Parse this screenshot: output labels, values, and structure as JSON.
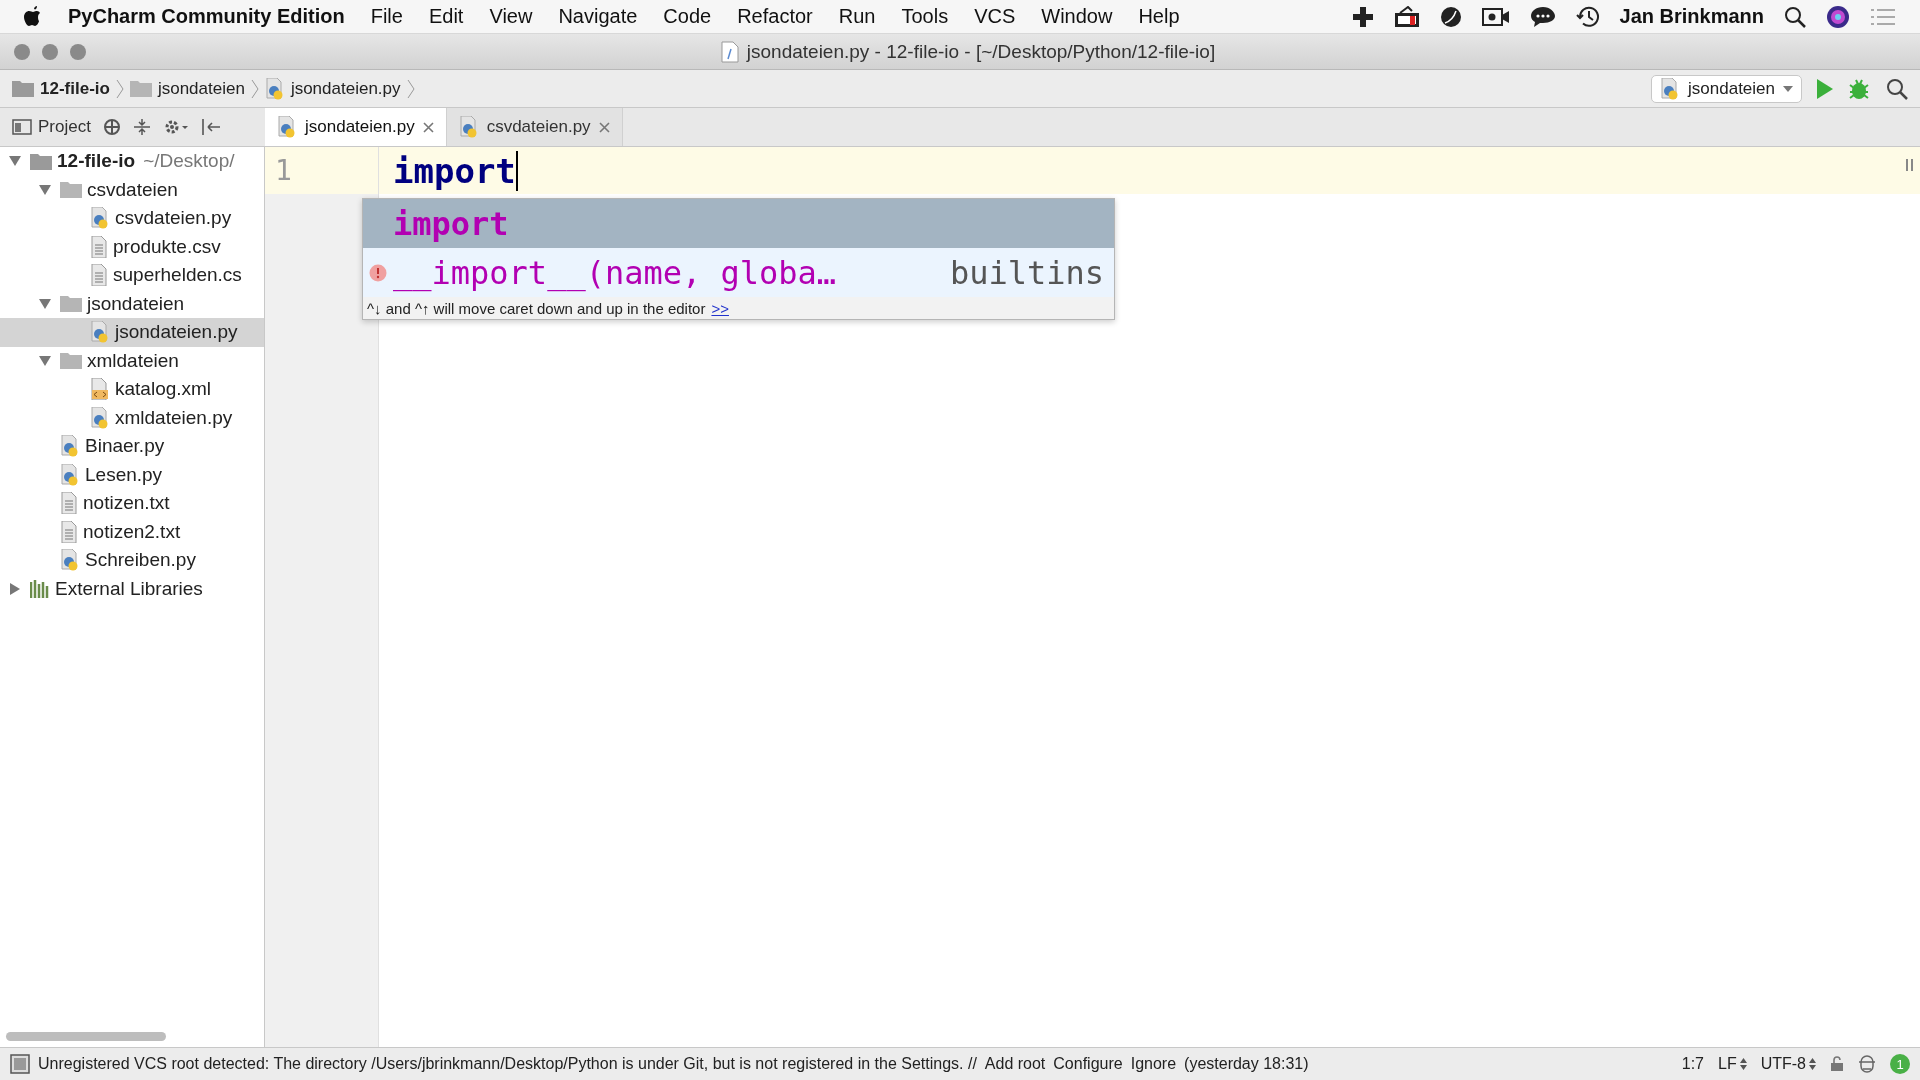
{
  "menu_bar": {
    "app_name": "PyCharm Community Edition",
    "items": [
      "File",
      "Edit",
      "View",
      "Navigate",
      "Code",
      "Refactor",
      "Run",
      "Tools",
      "VCS",
      "Window",
      "Help"
    ],
    "user_name": "Jan Brinkmann"
  },
  "title_bar": {
    "title": "jsondateien.py - 12-file-io - [~/Desktop/Python/12-file-io]"
  },
  "breadcrumbs": [
    {
      "label": "12-file-io",
      "kind": "root"
    },
    {
      "label": "jsondateien",
      "kind": "folder"
    },
    {
      "label": "jsondateien.py",
      "kind": "python"
    }
  ],
  "run_config": {
    "label": "jsondateien"
  },
  "project_tool": {
    "label": "Project"
  },
  "editor_tabs": [
    {
      "label": "jsondateien.py",
      "selected": true
    },
    {
      "label": "csvdateien.py",
      "selected": false
    }
  ],
  "tree": [
    {
      "label": "12-file-io",
      "detail": "~/Desktop/",
      "kind": "root",
      "expanded": true,
      "selected": false,
      "children": [
        {
          "label": "csvdateien",
          "kind": "folder",
          "expanded": true,
          "selected": false,
          "children": [
            {
              "label": "csvdateien.py",
              "kind": "python",
              "selected": false
            },
            {
              "label": "produkte.csv",
              "kind": "text",
              "selected": false
            },
            {
              "label": "superhelden.cs",
              "kind": "text",
              "selected": false
            }
          ]
        },
        {
          "label": "jsondateien",
          "kind": "folder",
          "expanded": true,
          "selected": false,
          "children": [
            {
              "label": "jsondateien.py",
              "kind": "python",
              "selected": true
            }
          ]
        },
        {
          "label": "xmldateien",
          "kind": "folder",
          "expanded": true,
          "selected": false,
          "children": [
            {
              "label": "katalog.xml",
              "kind": "xml",
              "selected": false
            },
            {
              "label": "xmldateien.py",
              "kind": "python",
              "selected": false
            }
          ]
        },
        {
          "label": "Binaer.py",
          "kind": "python",
          "selected": false
        },
        {
          "label": "Lesen.py",
          "kind": "python",
          "selected": false
        },
        {
          "label": "notizen.txt",
          "kind": "text",
          "selected": false
        },
        {
          "label": "notizen2.txt",
          "kind": "text",
          "selected": false
        },
        {
          "label": "Schreiben.py",
          "kind": "python",
          "selected": false
        }
      ]
    },
    {
      "label": "External Libraries",
      "kind": "library",
      "expanded": false,
      "selected": false
    }
  ],
  "editor": {
    "line_numbers": [
      "1"
    ],
    "code": "import"
  },
  "completion": {
    "items": [
      {
        "kind": "keyword",
        "text": "import",
        "selected": true
      },
      {
        "kind": "function",
        "text": "__import__(name, globa…",
        "source": "builtins",
        "selected": false
      }
    ],
    "hint": "^↓ and ^↑ will move caret down and up in the editor",
    "hint_link": ">>"
  },
  "status_bar": {
    "message": "Unregistered VCS root detected: The directory /Users/jbrinkmann/Desktop/Python is under Git, but is not registered in the Settings. //",
    "links": [
      "Add root",
      "Configure",
      "Ignore"
    ],
    "time": "(yesterday 18:31)",
    "position": "1:7",
    "line_separator": "LF",
    "encoding": "UTF-8",
    "notifications": "1"
  }
}
